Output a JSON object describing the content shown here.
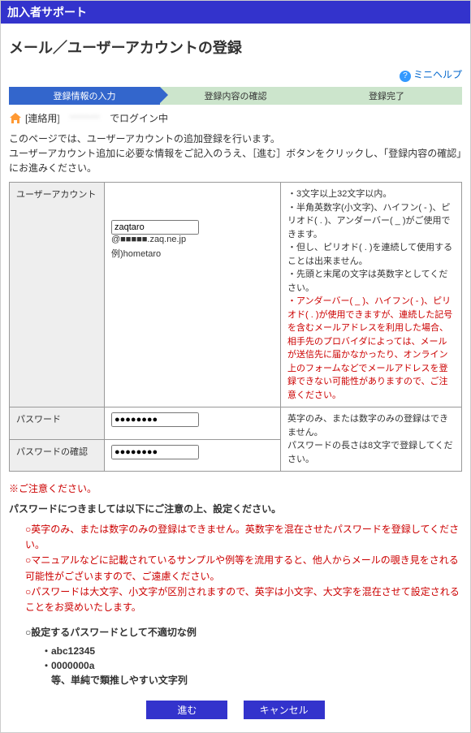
{
  "header": {
    "title": "加入者サポート"
  },
  "page": {
    "title": "メール／ユーザーアカウントの登録"
  },
  "minihelp": {
    "label": "ミニヘルプ"
  },
  "stepper": {
    "step1": "登録情報の入力",
    "step2": "登録内容の確認",
    "step3": "登録完了"
  },
  "login": {
    "prefix": "[連絡用]",
    "blur": "********",
    "suffix": "でログイン中"
  },
  "intro": {
    "line1": "このページでは、ユーザーアカウントの追加登録を行います。",
    "line2": "ユーザーアカウント追加に必要な情報をご記入のうえ、［進む］ボタンをクリックし、「登録内容の確認」にお進みください。"
  },
  "form": {
    "account": {
      "label": "ユーザーアカウント",
      "value": "zaqtaro",
      "suffix": "@■■■■■.zaq.ne.jp",
      "example_prefix": "例)",
      "example": "hometaro",
      "desc": {
        "n1": "・3文字以上32文字以内。",
        "n2": "・半角英数字(小文字)、ハイフン( - )、ピリオド( . )、アンダーバー( _ )がご使用できます。",
        "n3": "・但し、ピリオド( . )を連続して使用することは出来ません。",
        "n4": "・先頭と末尾の文字は英数字としてください。",
        "r1": "・アンダーバー( _ )、ハイフン( - )、ピリオド( . )が使用できますが、連続した記号を含むメールアドレスを利用した場合、相手先のプロバイダによっては、メールが送信先に届かなかったり、オンライン上のフォームなどでメールアドレスを登録できない可能性がありますので、ご注意ください。"
      }
    },
    "password": {
      "label": "パスワード",
      "value": "●●●●●●●●",
      "desc": {
        "n1": "英字のみ、または数字のみの登録はできません。",
        "n2": "パスワードの長さは8文字で登録してください。"
      }
    },
    "password_confirm": {
      "label": "パスワードの確認",
      "value": "●●●●●●●●"
    }
  },
  "note_title": "※ご注意ください。",
  "pw_title": "パスワードにつきましては以下にご注意の上、設定ください。",
  "pw_notes": {
    "i1": "○英字のみ、または数字のみの登録はできません。英数字を混在させたパスワードを登録してください。",
    "i2": "○マニュアルなどに記載されているサンプルや例等を流用すると、他人からメールの覗き見をされる可能性がございますので、ご遠慮ください。",
    "i3": "○パスワードは大文字、小文字が区別されますので、英字は小文字、大文字を混在させて設定されることをお奨めいたします。"
  },
  "bad_title": "○設定するパスワードとして不適切な例",
  "bad": {
    "b1": "・abc12345",
    "b2": "・0000000a",
    "b3": "　等、単純で類推しやすい文字列"
  },
  "buttons": {
    "submit": "進む",
    "cancel": "キャンセル"
  }
}
